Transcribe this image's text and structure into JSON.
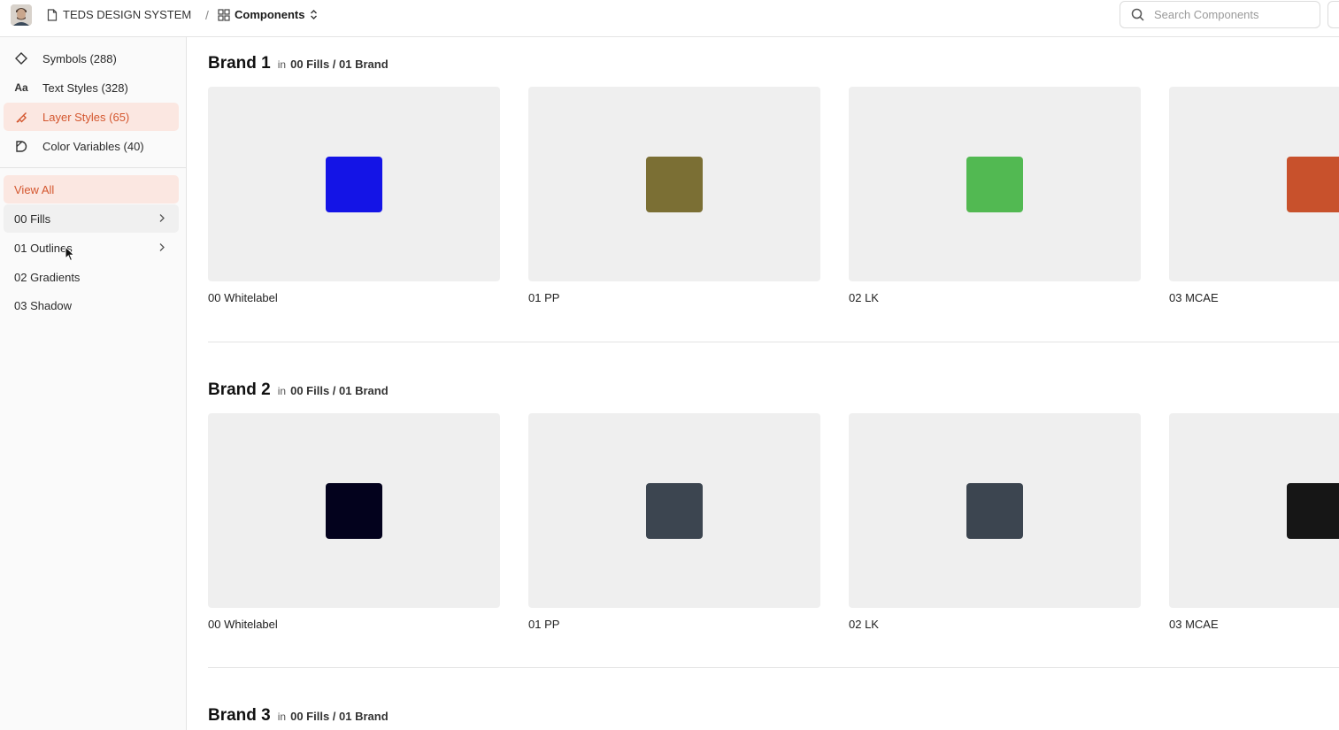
{
  "header": {
    "document_name": "TEDS DESIGN SYSTEM",
    "separator": "/",
    "section_name": "Components",
    "search_placeholder": "Search Components"
  },
  "sidebar": {
    "categories": [
      {
        "label": "Symbols (288)",
        "icon": "diamond-icon",
        "active": false
      },
      {
        "label": "Text Styles (328)",
        "icon": "text-aa-icon",
        "icon_text": "Aa",
        "active": false
      },
      {
        "label": "Layer Styles (65)",
        "icon": "brush-icon",
        "active": true
      },
      {
        "label": "Color Variables (40)",
        "icon": "color-drop-icon",
        "active": false
      }
    ],
    "filters": [
      {
        "label": "View All",
        "active": true,
        "has_children": false
      },
      {
        "label": "00 Fills",
        "active": false,
        "has_children": true,
        "hovered": true
      },
      {
        "label": "01 Outlines",
        "active": false,
        "has_children": true
      },
      {
        "label": "02 Gradients",
        "active": false,
        "has_children": false
      },
      {
        "label": "03 Shadow",
        "active": false,
        "has_children": false
      }
    ]
  },
  "sections": [
    {
      "title": "Brand 1",
      "in_label": "in",
      "path": "00 Fills / 01 Brand",
      "items": [
        {
          "label": "00 Whitelabel",
          "color": "#1414e6"
        },
        {
          "label": "01 PP",
          "color": "#7b6f34"
        },
        {
          "label": "02 LK",
          "color": "#52b952"
        },
        {
          "label": "03 MCAE",
          "color": "#c8512c"
        }
      ]
    },
    {
      "title": "Brand 2",
      "in_label": "in",
      "path": "00 Fills / 01 Brand",
      "items": [
        {
          "label": "00 Whitelabel",
          "color": "#03021d"
        },
        {
          "label": "01 PP",
          "color": "#3c4550"
        },
        {
          "label": "02 LK",
          "color": "#3c4550"
        },
        {
          "label": "03 MCAE",
          "color": "#161616"
        }
      ]
    },
    {
      "title": "Brand 3",
      "in_label": "in",
      "path": "00 Fills / 01 Brand",
      "items": []
    }
  ],
  "colors": {
    "accent": "#d4572f",
    "accent_bg": "#fbe7e1",
    "card_bg": "#efefef"
  }
}
